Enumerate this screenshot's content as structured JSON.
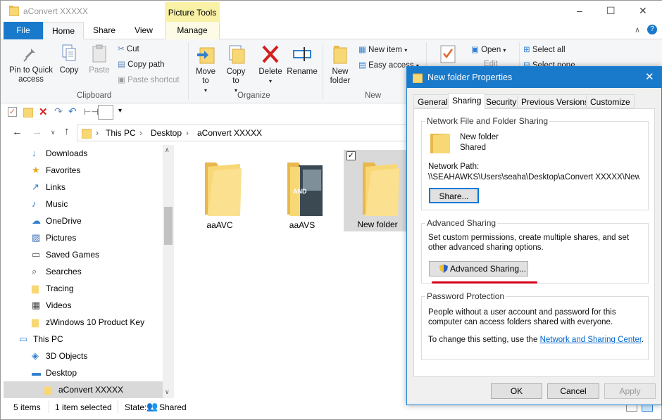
{
  "window": {
    "title": "aConvert XXXXX",
    "contextual_tab_group": "Picture Tools",
    "controls": {
      "minimize": "–",
      "maximize": "☐",
      "close": "✕"
    }
  },
  "ribbon_tabs": [
    "File",
    "Home",
    "Share",
    "View",
    "Manage"
  ],
  "ribbon": {
    "clipboard": {
      "pin": "Pin to Quick access",
      "copy": "Copy",
      "paste": "Paste",
      "cut": "Cut",
      "copy_path": "Copy path",
      "paste_shortcut": "Paste shortcut",
      "group": "Clipboard"
    },
    "organize": {
      "move_to": "Move to",
      "copy_to": "Copy to",
      "delete": "Delete",
      "rename": "Rename",
      "group": "Organize"
    },
    "new": {
      "new_folder": "New folder",
      "new_item": "New item",
      "easy_access": "Easy access",
      "group": "New"
    },
    "open": {
      "open": "Open",
      "edit": "Edit"
    },
    "select": {
      "select_all": "Select all",
      "select_none": "Select none"
    }
  },
  "address": {
    "path": [
      "This PC",
      "Desktop",
      "aConvert XXXXX"
    ],
    "separator": "›"
  },
  "nav_pane": {
    "items": [
      {
        "label": "Downloads",
        "icon": "download-arrow-icon",
        "indent": 1
      },
      {
        "label": "Favorites",
        "icon": "star-icon",
        "indent": 1
      },
      {
        "label": "Links",
        "icon": "link-arrow-icon",
        "indent": 1
      },
      {
        "label": "Music",
        "icon": "music-note-icon",
        "indent": 1
      },
      {
        "label": "OneDrive",
        "icon": "cloud-icon",
        "indent": 1
      },
      {
        "label": "Pictures",
        "icon": "pictures-icon",
        "indent": 1
      },
      {
        "label": "Saved Games",
        "icon": "gamepad-icon",
        "indent": 1
      },
      {
        "label": "Searches",
        "icon": "magnifier-icon",
        "indent": 1
      },
      {
        "label": "Tracing",
        "icon": "folder-icon",
        "indent": 1
      },
      {
        "label": "Videos",
        "icon": "film-icon",
        "indent": 1
      },
      {
        "label": "zWindows 10 Product Key",
        "icon": "folder-icon",
        "indent": 1
      },
      {
        "label": "This PC",
        "icon": "computer-icon",
        "indent": 0
      },
      {
        "label": "3D Objects",
        "icon": "cube-icon",
        "indent": 1
      },
      {
        "label": "Desktop",
        "icon": "desktop-icon",
        "indent": 1
      },
      {
        "label": "aConvert XXXXX",
        "icon": "folder-icon",
        "indent": 2,
        "selected": true
      }
    ]
  },
  "files": [
    {
      "name": "aaAVC",
      "type": "folder"
    },
    {
      "name": "aaAVS",
      "type": "folder-with-image",
      "image_text": "AND"
    },
    {
      "name": "New folder",
      "type": "folder",
      "selected": true
    }
  ],
  "status": {
    "items": "5 items",
    "selected": "1 item selected",
    "state_label": "State:",
    "state_value": "Shared"
  },
  "dialog": {
    "title": "New folder Properties",
    "tabs": [
      "General",
      "Sharing",
      "Security",
      "Previous Versions",
      "Customize"
    ],
    "active_tab": "Sharing",
    "network_sharing": {
      "title": "Network File and Folder Sharing",
      "folder_name": "New folder",
      "folder_state": "Shared",
      "path_label": "Network Path:",
      "path_value": "\\\\SEAHAWKS\\Users\\seaha\\Desktop\\aConvert XXXXX\\New f",
      "share_button": "Share..."
    },
    "advanced_sharing": {
      "title": "Advanced Sharing",
      "description": "Set custom permissions, create multiple shares, and set other advanced sharing options.",
      "button": "Advanced Sharing..."
    },
    "password": {
      "title": "Password Protection",
      "description": "People without a user account and password for this computer can access folders shared with everyone.",
      "change_text": "To change this setting, use the",
      "link": "Network and Sharing Center",
      "period": "."
    },
    "buttons": {
      "ok": "OK",
      "cancel": "Cancel",
      "apply": "Apply"
    }
  },
  "colors": {
    "accent": "#1979ca",
    "annotation_red": "#d5001c",
    "folder_yellow": "#f8d775",
    "picture_tools": "#f9f1a6"
  }
}
